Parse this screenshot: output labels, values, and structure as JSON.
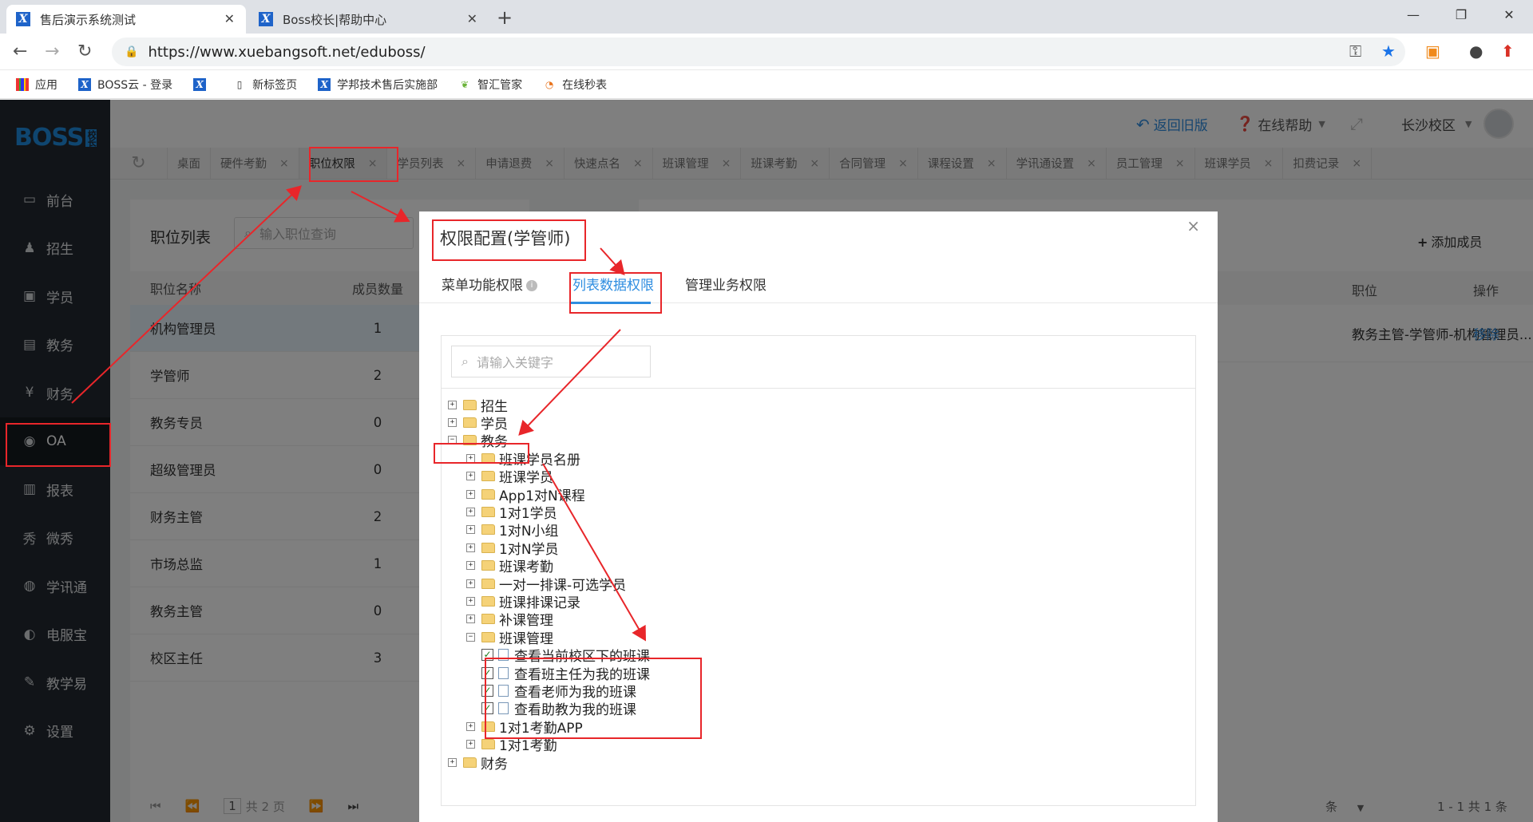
{
  "browser": {
    "tabs": [
      {
        "title": "售后演示系统测试",
        "active": true
      },
      {
        "title": "Boss校长|帮助中心",
        "active": false
      }
    ],
    "url": "https://www.xuebangsoft.net/eduboss/",
    "bookmarks": [
      "应用",
      "BOSS云 - 登录",
      "",
      "新标签页",
      "学邦技术售后实施部",
      "智汇管家",
      "在线秒表"
    ]
  },
  "app": {
    "logo": "BOSS",
    "logo_badge": "校长",
    "nav": [
      {
        "label": "前台",
        "icon": "calendar-icon",
        "glyph": "▭"
      },
      {
        "label": "招生",
        "icon": "user-add-icon",
        "glyph": "♟"
      },
      {
        "label": "学员",
        "icon": "student-icon",
        "glyph": "▣"
      },
      {
        "label": "教务",
        "icon": "book-icon",
        "glyph": "▤"
      },
      {
        "label": "财务",
        "icon": "yen-icon",
        "glyph": "¥"
      },
      {
        "label": "OA",
        "icon": "oa-icon",
        "glyph": "◉"
      },
      {
        "label": "报表",
        "icon": "bar-chart-icon",
        "glyph": "▥"
      },
      {
        "label": "微秀",
        "icon": "wei-icon",
        "glyph": "秀"
      },
      {
        "label": "学讯通",
        "icon": "location-icon",
        "glyph": "◍"
      },
      {
        "label": "电服宝",
        "icon": "phone-service-icon",
        "glyph": "◐"
      },
      {
        "label": "教学易",
        "icon": "teach-icon",
        "glyph": "✎"
      },
      {
        "label": "设置",
        "icon": "gear-icon",
        "glyph": "⚙"
      }
    ],
    "header": {
      "back_old": "返回旧版",
      "help": "在线帮助",
      "campus": "长沙校区"
    },
    "page_tabs": [
      "桌面",
      "硬件考勤",
      "职位权限",
      "学员列表",
      "申请退费",
      "快速点名",
      "班课管理",
      "班课考勤",
      "合同管理",
      "课程设置",
      "学讯通设置",
      "员工管理",
      "班课学员",
      "扣费记录"
    ],
    "left_panel": {
      "title": "职位列表",
      "search_placeholder": "输入职位查询",
      "col_name": "职位名称",
      "col_count": "成员数量",
      "rows": [
        {
          "name": "机构管理员",
          "count": "1"
        },
        {
          "name": "学管师",
          "count": "2"
        },
        {
          "name": "教务专员",
          "count": "0"
        },
        {
          "name": "超级管理员",
          "count": "0"
        },
        {
          "name": "财务主管",
          "count": "2"
        },
        {
          "name": "市场总监",
          "count": "1"
        },
        {
          "name": "教务主管",
          "count": "0"
        },
        {
          "name": "校区主任",
          "count": "3"
        }
      ],
      "pager_page": "1",
      "pager_total": "共 2 页"
    },
    "right_panel": {
      "add_member": "添加成员",
      "col_position": "职位",
      "col_action": "操作",
      "row_position": "教务主管-学管师-机构管理员...",
      "row_action": "移除",
      "pager_partial": "条",
      "pager_info": "1 - 1  共 1 条"
    }
  },
  "modal": {
    "title": "权限配置(学管师)",
    "tabs": [
      "菜单功能权限",
      "列表数据权限",
      "管理业务权限"
    ],
    "active_tab": 1,
    "search_placeholder": "请输入关键字",
    "tree": [
      {
        "label": "招生",
        "level": 0,
        "expand": "+",
        "type": "folder"
      },
      {
        "label": "学员",
        "level": 0,
        "expand": "+",
        "type": "folder"
      },
      {
        "label": "教务",
        "level": 0,
        "expand": "−",
        "type": "folder"
      },
      {
        "label": "班课学员名册",
        "level": 1,
        "expand": "+",
        "type": "folder"
      },
      {
        "label": "班课学员",
        "level": 1,
        "expand": "+",
        "type": "folder"
      },
      {
        "label": "App1对N课程",
        "level": 1,
        "expand": "+",
        "type": "folder"
      },
      {
        "label": "1对1学员",
        "level": 1,
        "expand": "+",
        "type": "folder"
      },
      {
        "label": "1对N小组",
        "level": 1,
        "expand": "+",
        "type": "folder"
      },
      {
        "label": "1对N学员",
        "level": 1,
        "expand": "+",
        "type": "folder"
      },
      {
        "label": "班课考勤",
        "level": 1,
        "expand": "+",
        "type": "folder"
      },
      {
        "label": "一对一排课-可选学员",
        "level": 1,
        "expand": "+",
        "type": "folder"
      },
      {
        "label": "班课排课记录",
        "level": 1,
        "expand": "+",
        "type": "folder"
      },
      {
        "label": "补课管理",
        "level": 1,
        "expand": "+",
        "type": "folder"
      },
      {
        "label": "班课管理",
        "level": 1,
        "expand": "−",
        "type": "folder"
      },
      {
        "label": "查看当前校区下的班课",
        "level": 2,
        "type": "leaf",
        "checked": true
      },
      {
        "label": "查看班主任为我的班课",
        "level": 2,
        "type": "leaf",
        "checked": true
      },
      {
        "label": "查看老师为我的班课",
        "level": 2,
        "type": "leaf",
        "checked": true
      },
      {
        "label": "查看助教为我的班课",
        "level": 2,
        "type": "leaf",
        "checked": true
      },
      {
        "label": "1对1考勤APP",
        "level": 1,
        "expand": "+",
        "type": "folder"
      },
      {
        "label": "1对1考勤",
        "level": 1,
        "expand": "+",
        "type": "folder"
      },
      {
        "label": "财务",
        "level": 0,
        "expand": "+",
        "type": "folder"
      }
    ]
  },
  "colors": {
    "sidebar_bg": "#222930",
    "accent_blue": "#2e8de0",
    "annotation_red": "#e8262a"
  }
}
